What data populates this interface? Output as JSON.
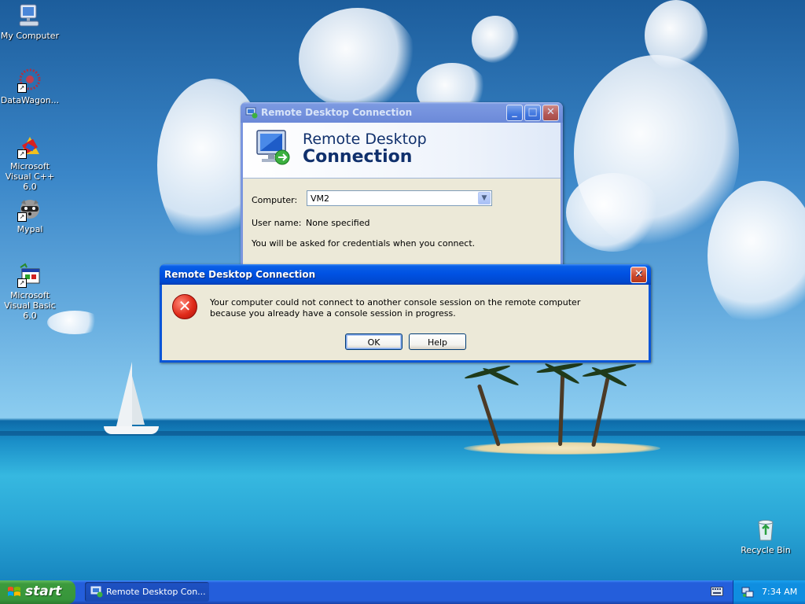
{
  "desktop": {
    "icons": [
      {
        "label": "My Computer",
        "icon": "my-computer-icon"
      },
      {
        "label": "DataWagon...",
        "icon": "datawagon-icon"
      },
      {
        "label": "Microsoft Visual C++ 6.0",
        "icon": "visual-cpp-icon"
      },
      {
        "label": "Mypal",
        "icon": "mypal-raccoon-icon"
      },
      {
        "label": "Microsoft Visual Basic 6.0",
        "icon": "visual-basic-icon"
      },
      {
        "label": "Recycle Bin",
        "icon": "recycle-bin-icon"
      }
    ]
  },
  "rdc_window": {
    "title": "Remote Desktop Connection",
    "banner_line1": "Remote Desktop",
    "banner_line2": "Connection",
    "computer_label": "Computer:",
    "computer_value": "VM2",
    "username_label": "User name:",
    "username_value": "None specified",
    "note": "You will be asked for credentials when you connect."
  },
  "error_dialog": {
    "title": "Remote Desktop Connection",
    "message": "Your computer could not connect to another console session on the remote computer because you already have a console session in progress.",
    "ok_label": "OK",
    "help_label": "Help",
    "icon": "error-x-icon"
  },
  "taskbar": {
    "start_label": "start",
    "task_label": "Remote Desktop Con...",
    "clock": "7:34 AM"
  },
  "colors": {
    "taskbar_blue": "#245edb",
    "start_green": "#3c9a3c",
    "dialog_bg": "#ece9d8",
    "close_red": "#c9462a"
  }
}
